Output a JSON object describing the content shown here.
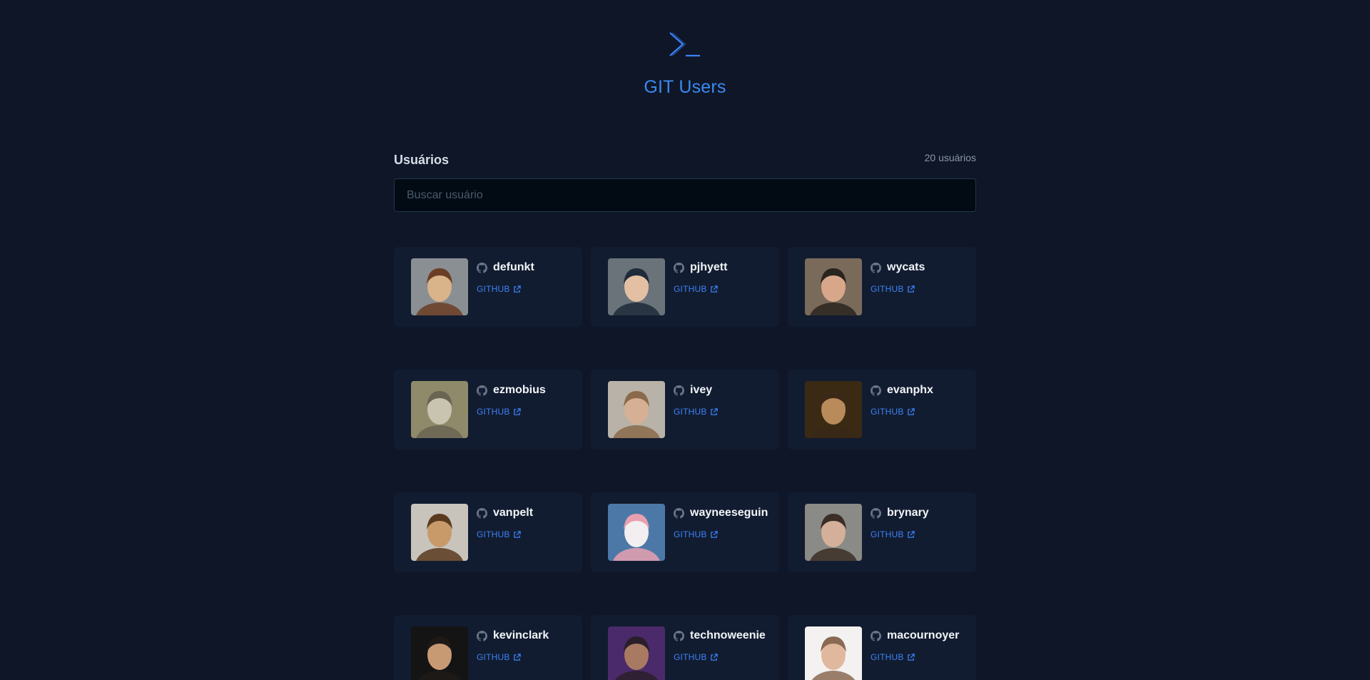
{
  "app": {
    "title": "GIT Users",
    "logo_icon": "terminal-prompt-icon",
    "accent_color": "#3b82f6"
  },
  "users_section": {
    "title": "Usuários",
    "count_label": "20 usuários",
    "search": {
      "placeholder": "Buscar usuário",
      "value": ""
    }
  },
  "link_label": "GITHUB",
  "users": [
    {
      "login": "defunkt",
      "avatar_bg": "#8a8f94",
      "avatar_fg": "#d9b38a",
      "hair": "#6b3d24"
    },
    {
      "login": "pjhyett",
      "avatar_bg": "#6a727a",
      "avatar_fg": "#e3c0a4",
      "hair": "#1f2a3a"
    },
    {
      "login": "wycats",
      "avatar_bg": "#7a6a5a",
      "avatar_fg": "#d8a78a",
      "hair": "#2a2420"
    },
    {
      "login": "ezmobius",
      "avatar_bg": "#8f8a6a",
      "avatar_fg": "#c9c4b0",
      "hair": "#6a6452"
    },
    {
      "login": "ivey",
      "avatar_bg": "#b8b2a8",
      "avatar_fg": "#d6b094",
      "hair": "#8a6a4a"
    },
    {
      "login": "evanphx",
      "avatar_bg": "#3a2a14",
      "avatar_fg": "#b98a5a",
      "hair": "#3b2818"
    },
    {
      "login": "vanpelt",
      "avatar_bg": "#c8c4bc",
      "avatar_fg": "#c89a6a",
      "hair": "#5a3a1e"
    },
    {
      "login": "wayneeseguin",
      "avatar_bg": "#4c78a8",
      "avatar_fg": "#f3eef0",
      "hair": "#e8a0b0"
    },
    {
      "login": "brynary",
      "avatar_bg": "#8a8a86",
      "avatar_fg": "#d4b09a",
      "hair": "#3a2e26"
    },
    {
      "login": "kevinclark",
      "avatar_bg": "#141414",
      "avatar_fg": "#c89a74",
      "hair": "#1e1a18"
    },
    {
      "login": "technoweenie",
      "avatar_bg": "#4a2a6a",
      "avatar_fg": "#a87a62",
      "hair": "#2a1e2a"
    },
    {
      "login": "macournoyer",
      "avatar_bg": "#f4f2f0",
      "avatar_fg": "#e0b89e",
      "hair": "#8a6a52"
    }
  ]
}
